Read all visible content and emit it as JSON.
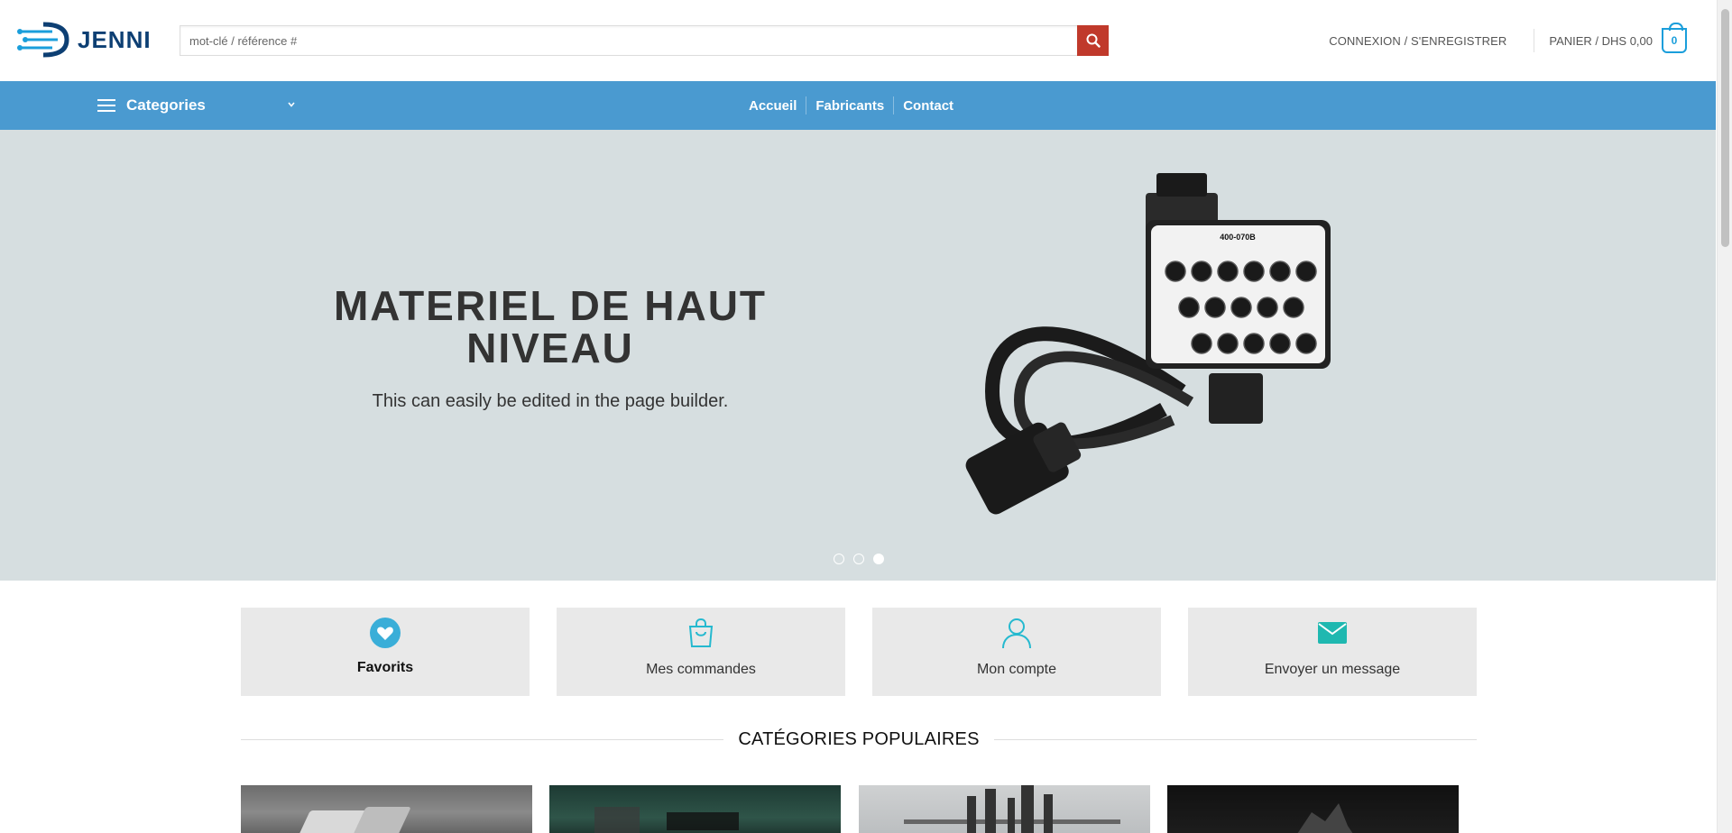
{
  "header": {
    "logo_text": "JENNI",
    "search_placeholder": "mot-clé / référence #",
    "login_label": "CONNEXION / S'ENREGISTRER",
    "cart_label": "PANIER / DHS 0,00",
    "cart_count": "0",
    "accent_color": "#c0392b"
  },
  "nav": {
    "categories_label": "Categories",
    "links": [
      "Accueil",
      "Fabricants",
      "Contact"
    ],
    "bar_color": "#4a9ad0"
  },
  "hero": {
    "title": "MATERIEL DE HAUT NIVEAU",
    "subtitle": "This can easily be edited in the page builder.",
    "slide_count": 3,
    "active_slide": 3,
    "product_label": "400-070B"
  },
  "quick_links": [
    {
      "label": "Favorits",
      "icon": "heart-icon"
    },
    {
      "label": "Mes commandes",
      "icon": "shopping-bag-icon"
    },
    {
      "label": "Mon compte",
      "icon": "user-icon"
    },
    {
      "label": "Envoyer un message",
      "icon": "envelope-icon"
    }
  ],
  "popular": {
    "title": "CATÉGORIES POPULAIRES"
  }
}
